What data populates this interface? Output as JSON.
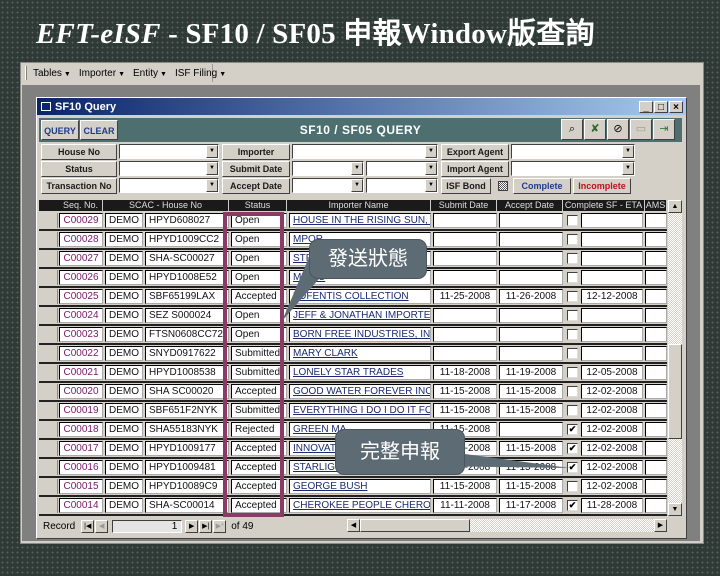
{
  "slide_title": {
    "italic": "EFT-eISF",
    "rest": " - SF10 / SF05 申報Window版查詢"
  },
  "menubar": [
    {
      "label": "Tables"
    },
    {
      "label": "Importer"
    },
    {
      "label": "Entity"
    },
    {
      "label": "ISF Filing"
    }
  ],
  "window": {
    "title": "SF10 Query",
    "controls": {
      "minimize": "_",
      "maximize": "□",
      "close": "×"
    }
  },
  "header": {
    "query_label": "QUERY",
    "clear_label": "CLEAR",
    "form_title": "SF10 / SF05 QUERY",
    "tools": [
      {
        "icon": "binoculars-icon",
        "glyph": "⚲"
      },
      {
        "icon": "satellite-icon",
        "glyph": "✗"
      },
      {
        "icon": "report-preview-icon",
        "glyph": "🔍"
      },
      {
        "icon": "blank-icon",
        "glyph": "▭"
      },
      {
        "icon": "exit-door-icon",
        "glyph": "⇥"
      }
    ]
  },
  "filters": {
    "house_no": {
      "label": "House No",
      "value": ""
    },
    "status": {
      "label": "Status",
      "value": ""
    },
    "transaction_no": {
      "label": "Transaction No",
      "value": ""
    },
    "importer": {
      "label": "Importer",
      "value": ""
    },
    "submit_date": {
      "label": "Submit Date",
      "from": "",
      "to": ""
    },
    "accept_date": {
      "label": "Accept Date",
      "from": "",
      "to": ""
    },
    "export_agent": {
      "label": "Export Agent",
      "value": ""
    },
    "import_agent": {
      "label": "Import Agent",
      "value": ""
    },
    "isf_bond": {
      "label": "ISF Bond",
      "state": "indeterminate"
    },
    "complete_label": "Complete",
    "incomplete_label": "Incomplete"
  },
  "colors": {
    "complete": "#1f3c8c",
    "incomplete": "#c0101a",
    "header_bg": "#4d6f70",
    "highlight": "#8b3a66",
    "callout": "#5d6b74"
  },
  "grid": {
    "columns": [
      "Seq. No.",
      "SCAC - House No",
      "Status",
      "Importer Name",
      "Submit Date",
      "Accept Date",
      "Complete SF - ETA",
      "AMS"
    ],
    "rows": [
      {
        "seq": "C00029",
        "scac": "DEMO",
        "house": "HPYD608027",
        "status": "Open",
        "importer": "HOUSE IN THE RISING SUN, INC",
        "submit": "",
        "accept": "",
        "complete": false,
        "eta": "",
        "ams": ""
      },
      {
        "seq": "C00028",
        "scac": "DEMO",
        "house": "HPYD1009CC2",
        "status": "Open",
        "importer": "MPOR",
        "submit": "",
        "accept": "",
        "complete": false,
        "eta": "",
        "ams": ""
      },
      {
        "seq": "C00027",
        "scac": "DEMO",
        "house": "SHA-SC00027",
        "status": "Open",
        "importer": "STFA",
        "submit": "",
        "accept": "",
        "complete": false,
        "eta": "",
        "ams": ""
      },
      {
        "seq": "C00026",
        "scac": "DEMO",
        "house": "HPYD1008E52",
        "status": "Open",
        "importer": "MEDIC",
        "submit": "",
        "accept": "",
        "complete": false,
        "eta": "",
        "ams": ""
      },
      {
        "seq": "C00025",
        "scac": "DEMO",
        "house": "SBF65199LAX",
        "status": "Accepted",
        "importer": "LOFENTIS COLLECTION",
        "submit": "11-25-2008",
        "accept": "11-26-2008",
        "complete": false,
        "eta": "12-12-2008",
        "ams": ""
      },
      {
        "seq": "C00024",
        "scac": "DEMO",
        "house": "SEZ S000024",
        "status": "Open",
        "importer": "JEFF & JONATHAN IMPORTER IN",
        "submit": "",
        "accept": "",
        "complete": false,
        "eta": "",
        "ams": ""
      },
      {
        "seq": "C00023",
        "scac": "DEMO",
        "house": "FTSN0608CC72",
        "status": "Open",
        "importer": "BORN FREE INDUSTRIES, INC",
        "submit": "",
        "accept": "",
        "complete": false,
        "eta": "",
        "ams": ""
      },
      {
        "seq": "C00022",
        "scac": "DEMO",
        "house": "SNYD0917622",
        "status": "Submitted",
        "importer": "MARY CLARK",
        "submit": "",
        "accept": "",
        "complete": false,
        "eta": "",
        "ams": ""
      },
      {
        "seq": "C00021",
        "scac": "DEMO",
        "house": "HPYD1008538",
        "status": "Submitted",
        "importer": "LONELY STAR TRADES",
        "submit": "11-18-2008",
        "accept": "11-19-2008",
        "complete": false,
        "eta": "12-05-2008",
        "ams": ""
      },
      {
        "seq": "C00020",
        "scac": "DEMO",
        "house": "SHA SC00020",
        "status": "Accepted",
        "importer": "GOOD WATER FOREVER INC",
        "submit": "11-15-2008",
        "accept": "11-15-2008",
        "complete": false,
        "eta": "12-02-2008",
        "ams": ""
      },
      {
        "seq": "C00019",
        "scac": "DEMO",
        "house": "SBF651F2NYK",
        "status": "Submitted",
        "importer": "EVERYTHING I DO I DO IT FOR Y",
        "submit": "11-15-2008",
        "accept": "11-15-2008",
        "complete": false,
        "eta": "12-02-2008",
        "ams": ""
      },
      {
        "seq": "C00018",
        "scac": "DEMO",
        "house": "SHA55183NYK",
        "status": "Rejected",
        "importer": "GREEN MA",
        "submit": "11-15-2008",
        "accept": "",
        "complete": true,
        "eta": "12-02-2008",
        "ams": ""
      },
      {
        "seq": "C00017",
        "scac": "DEMO",
        "house": "HPYD1009177",
        "status": "Accepted",
        "importer": "INNOVATIO",
        "submit": "11-15-2008",
        "accept": "11-15-2008",
        "complete": true,
        "eta": "12-02-2008",
        "ams": ""
      },
      {
        "seq": "C00016",
        "scac": "DEMO",
        "house": "HPYD1009481",
        "status": "Accepted",
        "importer": "STARLIGH",
        "submit": "11-15-2008",
        "accept": "11-15-2008",
        "complete": true,
        "eta": "12-02-2008",
        "ams": ""
      },
      {
        "seq": "C00015",
        "scac": "DEMO",
        "house": "HPYD10089C9",
        "status": "Accepted",
        "importer": "GEORGE BUSH",
        "submit": "11-15-2008",
        "accept": "11-15-2008",
        "complete": false,
        "eta": "12-02-2008",
        "ams": ""
      },
      {
        "seq": "C00014",
        "scac": "DEMO",
        "house": "SHA-SC00014",
        "status": "Accepted",
        "importer": "CHEROKEE PEOPLE CHEROKEE",
        "submit": "11-11-2008",
        "accept": "11-17-2008",
        "complete": true,
        "eta": "11-28-2008",
        "ams": ""
      }
    ]
  },
  "navigator": {
    "record_label": "Record",
    "current": "1",
    "of_label": "of 49"
  },
  "callouts": {
    "status": "發送狀態",
    "complete": "完整申報"
  }
}
